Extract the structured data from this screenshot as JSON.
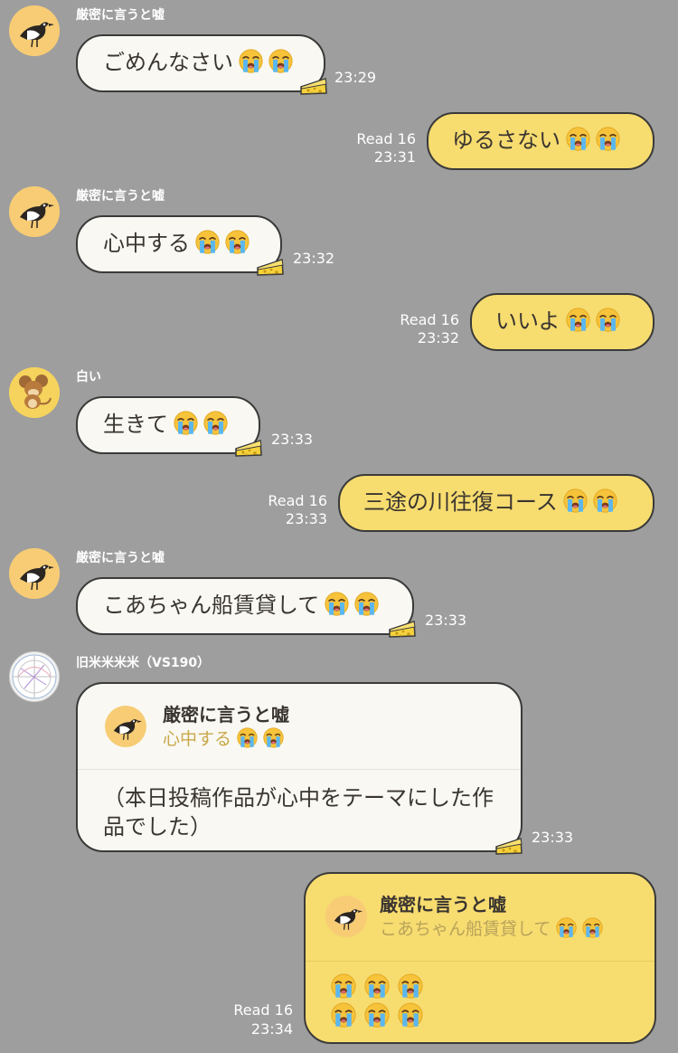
{
  "messages": {
    "m1": {
      "sender": "厳密に言うと嘘",
      "text": "ごめんなさい",
      "time": "23:29"
    },
    "m2": {
      "read": "Read 16",
      "text": "ゆるさない",
      "time": "23:31"
    },
    "m3": {
      "sender": "厳密に言うと嘘",
      "text": "心中する",
      "time": "23:32"
    },
    "m4": {
      "read": "Read 16",
      "text": "いいよ",
      "time": "23:32"
    },
    "m5": {
      "sender": "白い",
      "text": "生きて",
      "time": "23:33"
    },
    "m6": {
      "read": "Read 16",
      "text": "三途の川往復コース",
      "time": "23:33"
    },
    "m7": {
      "sender": "厳密に言うと嘘",
      "text": "こあちゃん船賃貸して",
      "time": "23:33"
    },
    "m8": {
      "sender": "旧米米米米（VS190）",
      "quote_name": "厳密に言うと嘘",
      "quote_text": "心中する",
      "text_line1": "（本日投稿作品が心中をテーマにした作",
      "text_line2": "品でした）",
      "time": "23:33"
    },
    "m9": {
      "read": "Read 16",
      "quote_name": "厳密に言うと嘘",
      "quote_text": "こあちゃん船賃貸して",
      "time": "23:34"
    }
  },
  "icons": {
    "emoji": "loudly-crying-face",
    "sticker": "cheese-icon",
    "avatars": [
      "bird-avatar",
      "mouse-avatar",
      "chart-avatar"
    ]
  },
  "colors": {
    "background": "#9e9e9e",
    "incoming_bubble": "#f9f8f2",
    "outgoing_bubble": "#f7dc70",
    "bubble_border": "#3a3a3a",
    "avatar_bird_bg": "#f7cc75"
  }
}
